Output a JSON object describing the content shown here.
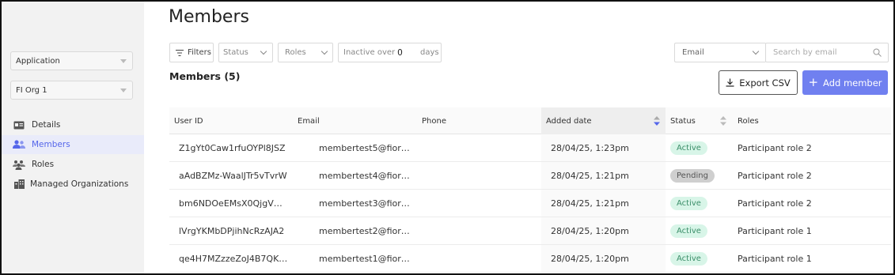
{
  "page": {
    "title": "Members"
  },
  "sidebar": {
    "app_select": "Application",
    "org_select": "FI Org 1",
    "items": [
      {
        "label": "Details",
        "icon": "card-icon",
        "active": false
      },
      {
        "label": "Members",
        "icon": "users-icon",
        "active": true
      },
      {
        "label": "Roles",
        "icon": "group-icon",
        "active": false
      },
      {
        "label": "Managed Organizations",
        "icon": "building-icon",
        "active": false
      }
    ]
  },
  "filters": {
    "filters_label": "Filters",
    "status_placeholder": "Status",
    "roles_placeholder": "Roles",
    "inactive_prefix": "Inactive over",
    "inactive_value": "0",
    "inactive_suffix": "days",
    "email_select": "Email",
    "search_placeholder": "Search by email"
  },
  "members": {
    "count_label": "Members (5)",
    "export_label": "Export CSV",
    "add_label": "Add member"
  },
  "table": {
    "columns": [
      "User ID",
      "Email",
      "Phone",
      "Added date",
      "Status",
      "Roles"
    ],
    "rows": [
      {
        "user_id": "Z1gYt0Caw1rfuOYPl8JSZ",
        "email": "membertest5@fior…",
        "phone": "",
        "added": "28/04/25, 1:23pm",
        "status": "Active",
        "role": "Participant role 2"
      },
      {
        "user_id": "aAdBZMz-WaalJTr5vTvrW",
        "email": "membertest4@fior…",
        "phone": "",
        "added": "28/04/25, 1:21pm",
        "status": "Pending",
        "role": "Participant role 2"
      },
      {
        "user_id": "bm6NDOeEMsX0QjgV…",
        "email": "membertest3@fior…",
        "phone": "",
        "added": "28/04/25, 1:21pm",
        "status": "Active",
        "role": "Participant role 2"
      },
      {
        "user_id": "lVrgYKMbDPjihNcRzAJA2",
        "email": "membertest2@fior…",
        "phone": "",
        "added": "28/04/25, 1:20pm",
        "status": "Active",
        "role": "Participant role 1"
      },
      {
        "user_id": "qe4H7MZzzeZoJ4B7QK…",
        "email": "membertest1@fior…",
        "phone": "",
        "added": "28/04/25, 1:20pm",
        "status": "Active",
        "role": "Participant role 1"
      }
    ]
  },
  "colors": {
    "accent": "#7080f0",
    "active_badge": "#d8f5e8",
    "pending_badge": "#cfcfcf"
  }
}
